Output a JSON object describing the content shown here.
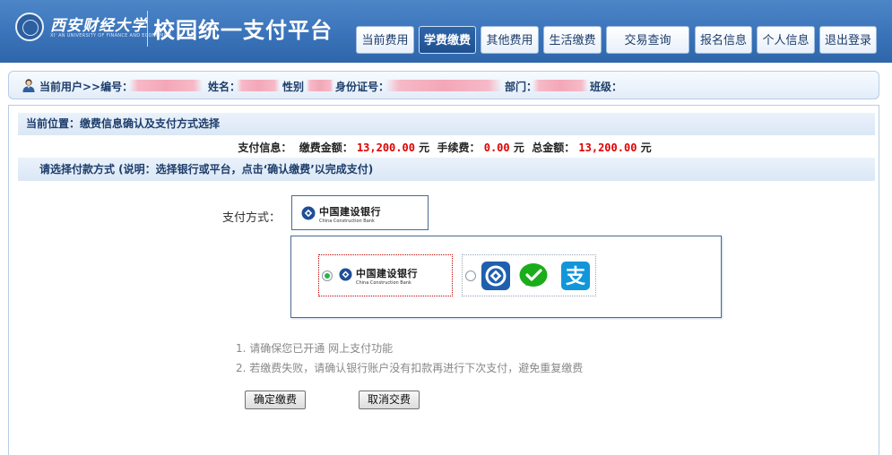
{
  "header": {
    "school_name": "西安财经大学",
    "school_name_en": "XI' AN UNIVERSITY OF FINANCE AND ECONOMICS",
    "platform_title": "校园统一支付平台",
    "nav": [
      {
        "label": "当前费用",
        "active": false
      },
      {
        "label": "学费缴费",
        "active": true
      },
      {
        "label": "其他费用",
        "active": false
      },
      {
        "label": "生活缴费",
        "active": false
      },
      {
        "label": "交易查询",
        "active": false
      },
      {
        "label": "报名信息",
        "active": false
      },
      {
        "label": "个人信息",
        "active": false
      },
      {
        "label": "退出登录",
        "active": false
      }
    ]
  },
  "userbar": {
    "current_user": "当前用户>>编号：",
    "name_label": "姓名：",
    "gender_label": "性别",
    "id_label": "身份证号：",
    "dept_label": "部门：",
    "class_label": "班级："
  },
  "location": "当前位置：缴费信息确认及支付方式选择",
  "pay_info": {
    "label": "支付信息：",
    "fee_label": "缴费金额：",
    "fee_amount": "13,200.00",
    "fee_unit": "元",
    "service_label": "手续费：",
    "service_amount": "0.00",
    "service_unit": "元",
    "total_label": "总金额：",
    "total_amount": "13,200.00",
    "total_unit": "元"
  },
  "select_prompt": "请选择付款方式 (说明：选择银行或平台，点击‘确认缴费’以完成支付)",
  "payment": {
    "label": "支付方式：",
    "bank_cn": "中国建设银行",
    "bank_en": "China Construction Bank",
    "selected_option": "ccb"
  },
  "notes": [
    "1. 请确保您已开通 网上支付功能",
    "2. 若缴费失败，请确认银行账户没有扣款再进行下次支付，避免重复缴费"
  ],
  "buttons": {
    "confirm": "确定缴费",
    "cancel": "取消交费"
  },
  "colors": {
    "header_blue": "#3a73b9",
    "amount_red": "#e00000",
    "wechat_green": "#1aad19",
    "alipay_blue": "#1296db"
  }
}
